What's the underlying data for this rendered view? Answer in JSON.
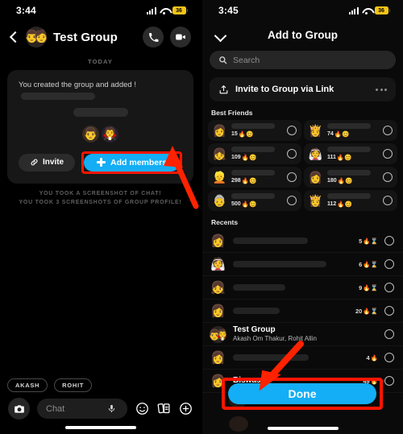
{
  "left": {
    "status": {
      "time": "3:44",
      "battery": "36",
      "signal_icon": "cellular-signal-icon",
      "wifi_icon": "wifi-icon",
      "battery_icon": "battery-low-power-icon"
    },
    "header": {
      "back_icon": "back-chevron-icon",
      "title": "Test Group",
      "call_icon": "phone-call-icon",
      "video_icon": "video-call-icon",
      "avatar_icon": "group-avatar-icon",
      "avatar_emoji_1": "👨",
      "avatar_emoji_2": "🧑"
    },
    "day_divider": "TODAY",
    "bubble": {
      "text": "You created the group and added !",
      "avatar_1": "👨",
      "avatar_2": "🧛",
      "invite_label": "Invite",
      "invite_icon": "link-chain-icon",
      "add_members_label": "Add members",
      "add_members_icon": "plus-icon"
    },
    "notices": [
      "YOU TOOK A SCREENSHOT OF CHAT!",
      "YOU TOOK 3 SCREENSHOTS OF GROUP PROFILE!"
    ],
    "chips": [
      "AKASH",
      "ROHIT"
    ],
    "composer": {
      "camera_icon": "camera-icon",
      "chat_placeholder": "Chat",
      "mic_icon": "microphone-icon",
      "emoji_icon": "smiley-face-icon",
      "sticker_icon": "sticker-cards-icon",
      "plus_icon": "plus-circle-icon"
    },
    "highlight_color": "#ff1500",
    "accent_color": "#13aef5"
  },
  "right": {
    "status": {
      "time": "3:45",
      "battery": "36"
    },
    "header": {
      "collapse_icon": "chevron-down-icon",
      "title": "Add to Group"
    },
    "search": {
      "placeholder": "Search",
      "icon": "search-icon"
    },
    "invite_link": {
      "label": "Invite to Group via Link",
      "icon": "share-upload-icon",
      "more_icon": "more-options-icon"
    },
    "sections": {
      "best_friends": "Best Friends",
      "recents": "Recents"
    },
    "best_friends": [
      {
        "avatar": "👩",
        "streak": "15",
        "emoji": "🔥😊"
      },
      {
        "avatar": "👸",
        "streak": "74",
        "emoji": "🔥😊"
      },
      {
        "avatar": "👧",
        "streak": "109",
        "emoji": "🔥😊"
      },
      {
        "avatar": "👰",
        "streak": "111",
        "emoji": "🔥😊"
      },
      {
        "avatar": "👱",
        "streak": "298",
        "emoji": "🔥😊"
      },
      {
        "avatar": "👩",
        "streak": "180",
        "emoji": "🔥😊"
      },
      {
        "avatar": "👵",
        "streak": "500",
        "emoji": "🔥😊"
      },
      {
        "avatar": "👸",
        "streak": "112",
        "emoji": "🔥😊"
      }
    ],
    "recents": [
      {
        "avatar": "👩",
        "name": "",
        "sub": "",
        "streak": "5",
        "emoji": "🔥⌛",
        "redacted": true
      },
      {
        "avatar": "👰",
        "name": "",
        "sub": "",
        "streak": "6",
        "emoji": "🔥⌛",
        "redacted": true
      },
      {
        "avatar": "👧",
        "name": "",
        "sub": "",
        "streak": "9",
        "emoji": "🔥⌛",
        "redacted": true
      },
      {
        "avatar": "👩",
        "name": "",
        "sub": "",
        "streak": "20",
        "emoji": "🔥⌛",
        "redacted": true
      },
      {
        "avatar": "👨",
        "name": "Test Group",
        "sub": "Akash Om Thakur, Rohit Allin",
        "streak": "",
        "emoji": "",
        "redacted": false
      },
      {
        "avatar": "👩",
        "name": "",
        "sub": "",
        "streak": "4",
        "emoji": "🔥",
        "redacted": true
      },
      {
        "avatar": "👩",
        "name": "Biswas",
        "sub": "",
        "streak": "49",
        "emoji": "🔥",
        "redacted": true
      }
    ],
    "done_label": "Done",
    "highlight_color": "#ff1500",
    "accent_color": "#13aef5"
  }
}
